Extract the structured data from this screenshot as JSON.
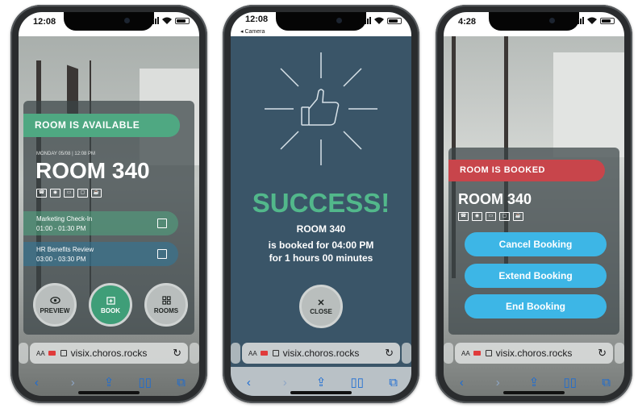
{
  "phones": [
    {
      "status": {
        "time": "12:08"
      },
      "panel": {
        "banner": "ROOM IS AVAILABLE",
        "date": "MONDAY 05/08 | 12:08 PM",
        "room": "ROOM 340",
        "amenities": [
          "phone-icon",
          "projector-icon",
          "display-icon",
          "monitor-icon",
          "coffee-icon"
        ],
        "meetings": [
          {
            "title": "Marketing Check-In",
            "time": "01:00 - 01:30 PM"
          },
          {
            "title": "HR Benefits Review",
            "time": "03:00 - 03:30 PM"
          }
        ],
        "buttons": {
          "preview": "PREVIEW",
          "book": "BOOK",
          "rooms": "ROOMS"
        }
      },
      "browser": {
        "aa": "AA",
        "url": "visix.choros.rocks"
      }
    },
    {
      "status": {
        "time": "12:08",
        "back": "◂ Camera"
      },
      "success": {
        "headline": "SUCCESS!",
        "room": "ROOM 340",
        "line1": "is booked for 04:00 PM",
        "line2": "for 1 hours 00 minutes",
        "close": "CLOSE"
      },
      "browser": {
        "aa": "AA",
        "url": "visix.choros.rocks"
      }
    },
    {
      "status": {
        "time": "4:28"
      },
      "panel": {
        "banner": "ROOM IS BOOKED",
        "room": "ROOM 340",
        "amenities": [
          "phone-icon",
          "projector-icon",
          "display-icon",
          "monitor-icon",
          "coffee-icon"
        ],
        "actions": [
          "Cancel Booking",
          "Extend Booking",
          "End Booking"
        ]
      },
      "browser": {
        "aa": "AA",
        "url": "visix.choros.rocks"
      }
    }
  ],
  "colors": {
    "available": "#4fa882",
    "booked": "#c8454b",
    "success_bg": "#3a5568",
    "success_text": "#52b88b",
    "action_blue": "#3db6e6",
    "safari_blue": "#1b6cd4"
  },
  "toolbar_icons": [
    "back-icon",
    "forward-icon",
    "share-icon",
    "bookmarks-icon",
    "tabs-icon"
  ]
}
